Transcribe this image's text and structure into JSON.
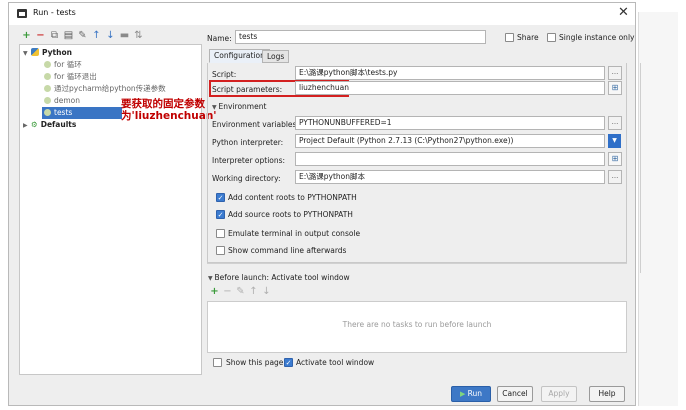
{
  "window": {
    "title": "Run - tests"
  },
  "tree": {
    "python_label": "Python",
    "items": [
      {
        "label": "for 循环"
      },
      {
        "label": "for 循环退出"
      },
      {
        "label": "通过pycharm给python传递参数"
      },
      {
        "label": "demon"
      },
      {
        "label": "tests"
      }
    ],
    "defaults_label": "Defaults"
  },
  "annotation": {
    "text": "要获取的固定参数为'liuzhenchuan'"
  },
  "name": {
    "label": "Name:",
    "value": "tests"
  },
  "share": {
    "label": "Share"
  },
  "single_instance": {
    "label": "Single instance only"
  },
  "tabs": [
    {
      "label": "Configuration"
    },
    {
      "label": "Logs"
    }
  ],
  "fields": {
    "script": {
      "label": "Script:",
      "value": "E:\\潞课python脚本\\tests.py"
    },
    "script_params": {
      "label": "Script parameters:",
      "value": "liuzhenchuan"
    },
    "environment_header": "Environment",
    "env_vars": {
      "label": "Environment variables:",
      "value": "PYTHONUNBUFFERED=1"
    },
    "interpreter": {
      "label": "Python interpreter:",
      "value": "Project Default (Python 2.7.13 (C:\\Python27\\python.exe))"
    },
    "interp_opts": {
      "label": "Interpreter options:",
      "value": ""
    },
    "workdir": {
      "label": "Working directory:",
      "value": "E:\\潞课python脚本"
    }
  },
  "checkboxes": {
    "content_roots": {
      "label": "Add content roots to PYTHONPATH",
      "checked": true
    },
    "source_roots": {
      "label": "Add source roots to PYTHONPATH",
      "checked": true
    },
    "emulate_terminal": {
      "label": "Emulate terminal in output console",
      "checked": false
    },
    "show_cmdline": {
      "label": "Show command line afterwards",
      "checked": false
    }
  },
  "before_launch": {
    "header": "Before launch: Activate tool window",
    "empty_text": "There are no tasks to run before launch"
  },
  "bottom": {
    "show_page": {
      "label": "Show this page",
      "checked": false
    },
    "activate_tool": {
      "label": "Activate tool window",
      "checked": true
    }
  },
  "buttons": {
    "run": "Run",
    "cancel": "Cancel",
    "apply": "Apply",
    "help": "Help"
  },
  "colors": {
    "accent": "#3d78c6",
    "selection": "#3a75c4",
    "annotation": "#c00000",
    "highlight_box": "#d32020"
  }
}
